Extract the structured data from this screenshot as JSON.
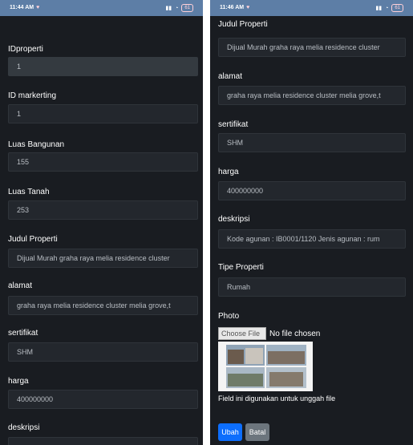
{
  "left": {
    "status": {
      "time": "11:44 AM",
      "battery": "61"
    },
    "fields": [
      {
        "label": "IDproperti",
        "value": "1"
      },
      {
        "label": "ID markerting",
        "value": "1"
      },
      {
        "label": "Luas Bangunan",
        "value": "155"
      },
      {
        "label": "Luas Tanah",
        "value": "253"
      },
      {
        "label": "Judul Properti",
        "value": "Dijual Murah graha raya melia residence cluster"
      },
      {
        "label": "alamat",
        "value": "graha raya melia residence cluster melia grove,t"
      },
      {
        "label": "sertifikat",
        "value": "SHM"
      },
      {
        "label": "harga",
        "value": "400000000"
      },
      {
        "label": "deskripsi",
        "value": ""
      }
    ]
  },
  "right": {
    "status": {
      "time": "11:46 AM",
      "battery": "61"
    },
    "fields": [
      {
        "label": "Judul Properti",
        "value": "Dijual Murah graha raya melia residence cluster"
      },
      {
        "label": "alamat",
        "value": "graha raya melia residence cluster melia grove,t"
      },
      {
        "label": "sertifikat",
        "value": "SHM"
      },
      {
        "label": "harga",
        "value": "400000000"
      },
      {
        "label": "deskripsi",
        "value": "Kode agunan : IB0001/1120 Jenis agunan : rum"
      },
      {
        "label": "Tipe Properti",
        "value": "Rumah"
      }
    ],
    "photo_label": "Photo",
    "choose_label": "Choose File",
    "no_file": "No file chosen",
    "help_text": "Field ini digunakan untuk unggah file",
    "submit_label": "Ubah",
    "cancel_label": "Batal"
  },
  "colors": {
    "background": "#191c21",
    "primary": "#0d6efd",
    "secondary": "#6c757d"
  }
}
